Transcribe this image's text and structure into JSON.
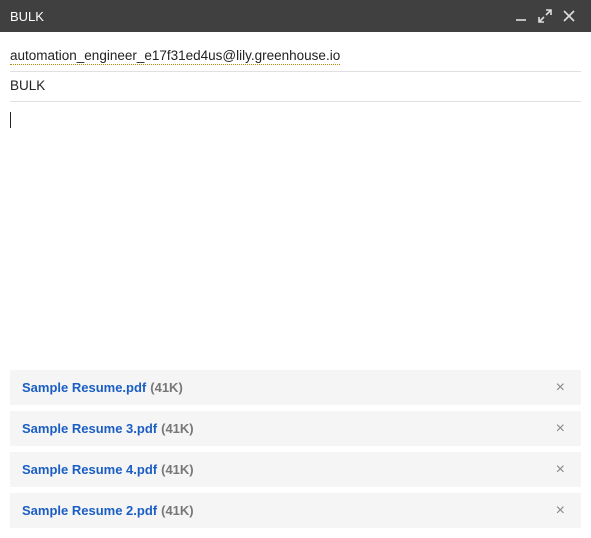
{
  "window": {
    "title": "BULK"
  },
  "compose": {
    "recipient": "automation_engineer_e17f31ed4us@lily.greenhouse.io",
    "subject": "BULK",
    "body": ""
  },
  "attachments": [
    {
      "name": "Sample Resume.pdf",
      "size": "(41K)"
    },
    {
      "name": "Sample Resume 3.pdf",
      "size": "(41K)"
    },
    {
      "name": "Sample Resume 4.pdf",
      "size": "(41K)"
    },
    {
      "name": "Sample Resume 2.pdf",
      "size": "(41K)"
    }
  ]
}
